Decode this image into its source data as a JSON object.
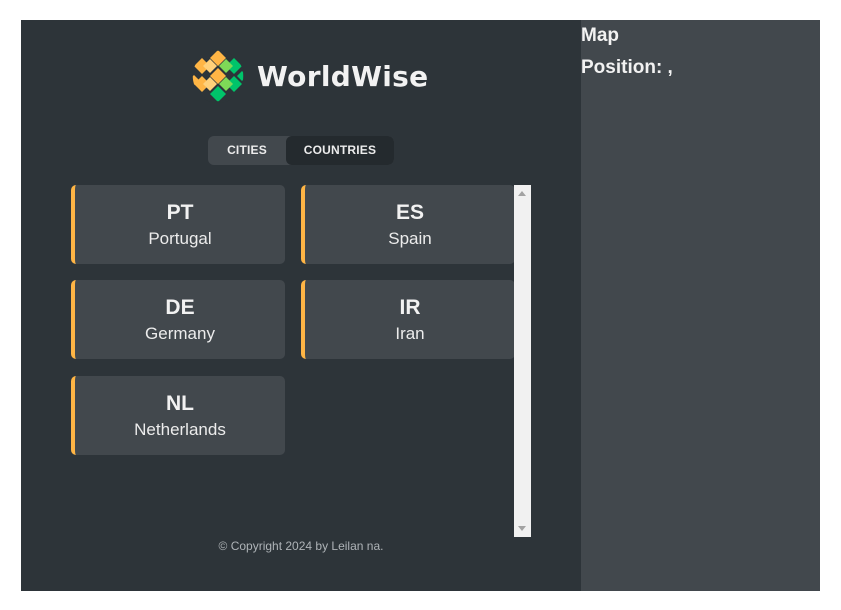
{
  "app": {
    "name": "WorldWise"
  },
  "tabs": [
    {
      "label": "CITIES",
      "active": false
    },
    {
      "label": "COUNTRIES",
      "active": true
    }
  ],
  "countries": [
    {
      "code": "PT",
      "name": "Portugal"
    },
    {
      "code": "ES",
      "name": "Spain"
    },
    {
      "code": "DE",
      "name": "Germany"
    },
    {
      "code": "IR",
      "name": "Iran"
    },
    {
      "code": "NL",
      "name": "Netherlands"
    }
  ],
  "footer": {
    "copyright": "© Copyright 2024 by Leilan na."
  },
  "map": {
    "title": "Map",
    "position_label": "Position: ,"
  },
  "colors": {
    "sidebar_bg": "#2d3439",
    "card_bg": "#42484d",
    "accent_orange": "#ffb545",
    "accent_green": "#00c46a",
    "map_bg": "#42484d"
  }
}
